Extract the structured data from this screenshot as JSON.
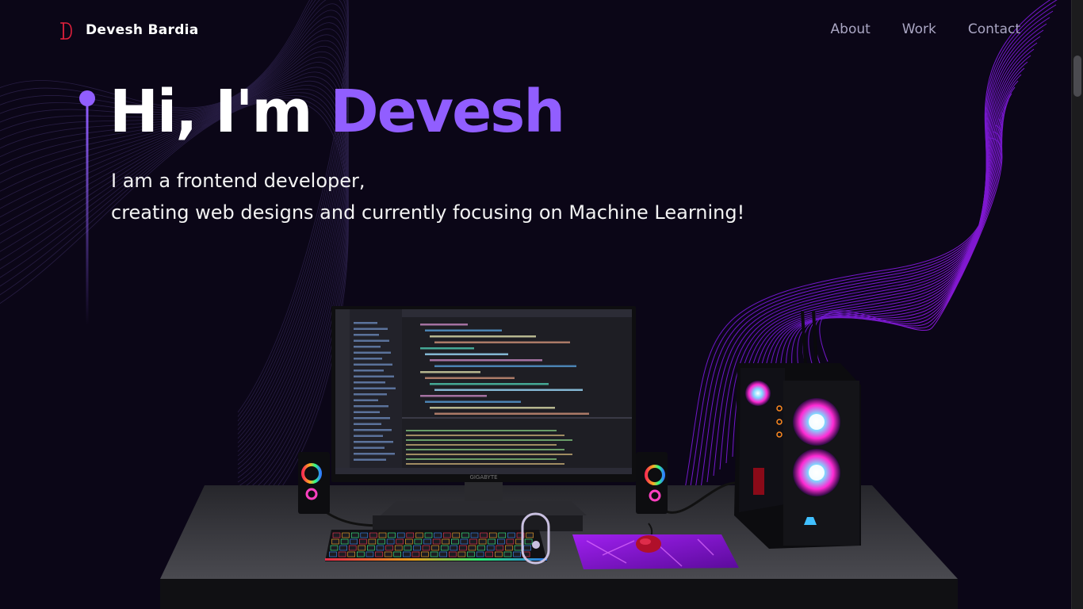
{
  "nav": {
    "brand": "Devesh Bardia",
    "links": [
      {
        "label": "About"
      },
      {
        "label": "Work"
      },
      {
        "label": "Contact"
      }
    ]
  },
  "hero": {
    "greeting": "Hi, I'm ",
    "name": "Devesh",
    "line1": "I am a frontend developer,",
    "line2": "creating web designs and currently focusing on Machine Learning!"
  },
  "monitor": {
    "brand": "GIGABYTE"
  },
  "colors": {
    "background": "#0b0617",
    "accent": "#915eff",
    "nav_text": "#aaa6c3"
  },
  "icons": {
    "logo": "d-monogram-icon"
  }
}
